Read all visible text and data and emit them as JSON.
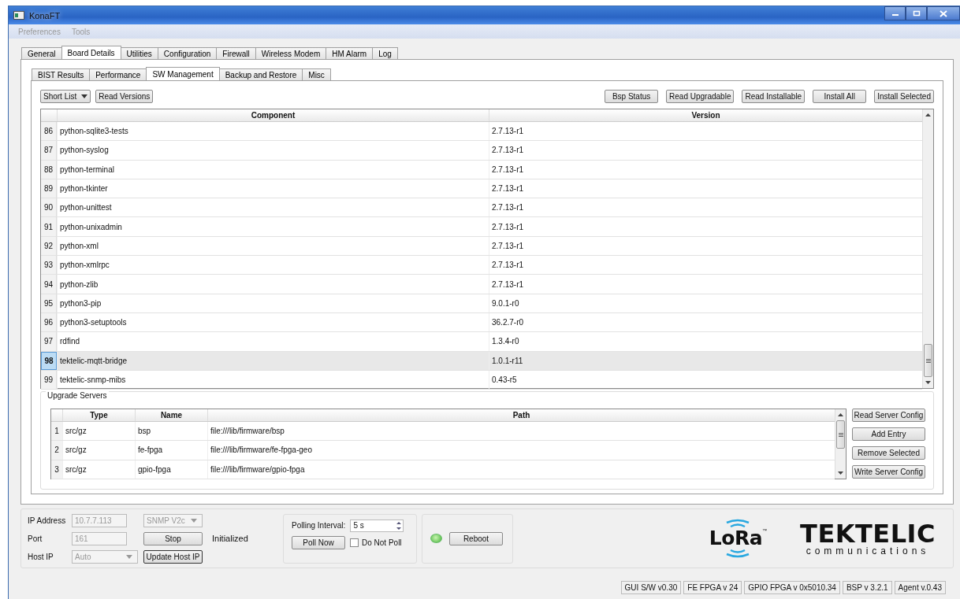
{
  "window": {
    "title": "KonaFT"
  },
  "menu": [
    {
      "label": "Preferences",
      "disabled": true
    },
    {
      "label": "Tools",
      "disabled": true
    }
  ],
  "tabs": [
    {
      "label": "General",
      "selected": false
    },
    {
      "label": "Board Details",
      "selected": true
    },
    {
      "label": "Utilities",
      "selected": false
    },
    {
      "label": "Configuration",
      "selected": false
    },
    {
      "label": "Firewall",
      "selected": false
    },
    {
      "label": "Wireless Modem",
      "selected": false
    },
    {
      "label": "HM Alarm",
      "selected": false
    },
    {
      "label": "Log",
      "selected": false
    }
  ],
  "subtabs": [
    {
      "label": "BIST Results",
      "selected": false
    },
    {
      "label": "Performance",
      "selected": false
    },
    {
      "label": "SW Management",
      "selected": true
    },
    {
      "label": "Backup and Restore",
      "selected": false
    },
    {
      "label": "Misc",
      "selected": false
    }
  ],
  "list_dropdown": {
    "value": "Short List"
  },
  "left_buttons": [
    "Read Versions"
  ],
  "right_buttons": [
    "Bsp Status",
    "Read Upgradable",
    "Read Installable",
    "Install All",
    "Install Selected"
  ],
  "components_table": {
    "columns": [
      "Component",
      "Version"
    ],
    "rows": [
      {
        "number": "86",
        "component": "python-sqlite3-tests",
        "version": "2.7.13-r1",
        "selected": false
      },
      {
        "number": "87",
        "component": "python-syslog",
        "version": "2.7.13-r1",
        "selected": false
      },
      {
        "number": "88",
        "component": "python-terminal",
        "version": "2.7.13-r1",
        "selected": false
      },
      {
        "number": "89",
        "component": "python-tkinter",
        "version": "2.7.13-r1",
        "selected": false
      },
      {
        "number": "90",
        "component": "python-unittest",
        "version": "2.7.13-r1",
        "selected": false
      },
      {
        "number": "91",
        "component": "python-unixadmin",
        "version": "2.7.13-r1",
        "selected": false
      },
      {
        "number": "92",
        "component": "python-xml",
        "version": "2.7.13-r1",
        "selected": false
      },
      {
        "number": "93",
        "component": "python-xmlrpc",
        "version": "2.7.13-r1",
        "selected": false
      },
      {
        "number": "94",
        "component": "python-zlib",
        "version": "2.7.13-r1",
        "selected": false
      },
      {
        "number": "95",
        "component": "python3-pip",
        "version": "9.0.1-r0",
        "selected": false
      },
      {
        "number": "96",
        "component": "python3-setuptools",
        "version": "36.2.7-r0",
        "selected": false
      },
      {
        "number": "97",
        "component": "rdfind",
        "version": "1.3.4-r0",
        "selected": false
      },
      {
        "number": "98",
        "component": "tektelic-mqtt-bridge",
        "version": "1.0.1-r11",
        "selected": true
      },
      {
        "number": "99",
        "component": "tektelic-snmp-mibs",
        "version": "0.43-r5",
        "selected": false
      }
    ]
  },
  "upgrade_servers": {
    "title": "Upgrade Servers",
    "columns": [
      "Type",
      "Name",
      "Path"
    ],
    "rows": [
      {
        "number": "1",
        "type": "src/gz",
        "name": "bsp",
        "path": "file:///lib/firmware/bsp"
      },
      {
        "number": "2",
        "type": "src/gz",
        "name": "fe-fpga",
        "path": "file:///lib/firmware/fe-fpga-geo"
      },
      {
        "number": "3",
        "type": "src/gz",
        "name": "gpio-fpga",
        "path": "file:///lib/firmware/gpio-fpga"
      }
    ],
    "buttons": [
      "Read Server Config",
      "Add Entry",
      "Remove Selected",
      "Write Server Config"
    ]
  },
  "connection": {
    "ip_label": "IP Address",
    "ip_value": "10.7.7.113",
    "port_label": "Port",
    "port_value": "161",
    "host_label": "Host IP",
    "host_value": "Auto",
    "fields_disabled": true,
    "protocol": "SNMP V2c",
    "stop_button": "Stop",
    "update_button": "Update Host IP",
    "status": "Initialized"
  },
  "polling": {
    "label": "Polling Interval:",
    "value": "5 s",
    "poll_button": "Poll Now",
    "checkbox": {
      "label": "Do Not Poll",
      "checked": false
    }
  },
  "device": {
    "led_on": true,
    "reboot_button": "Reboot"
  },
  "logos": {
    "lora": "LoRa",
    "lora_mark": "™",
    "company": "TEKTELIC",
    "tagline": "communications"
  },
  "status_bar": [
    "GUI S/W v0.30",
    "FE FPGA v 24",
    "GPIO FPGA v 0x5010.34",
    "BSP v 3.2.1",
    "Agent v.0.43"
  ]
}
